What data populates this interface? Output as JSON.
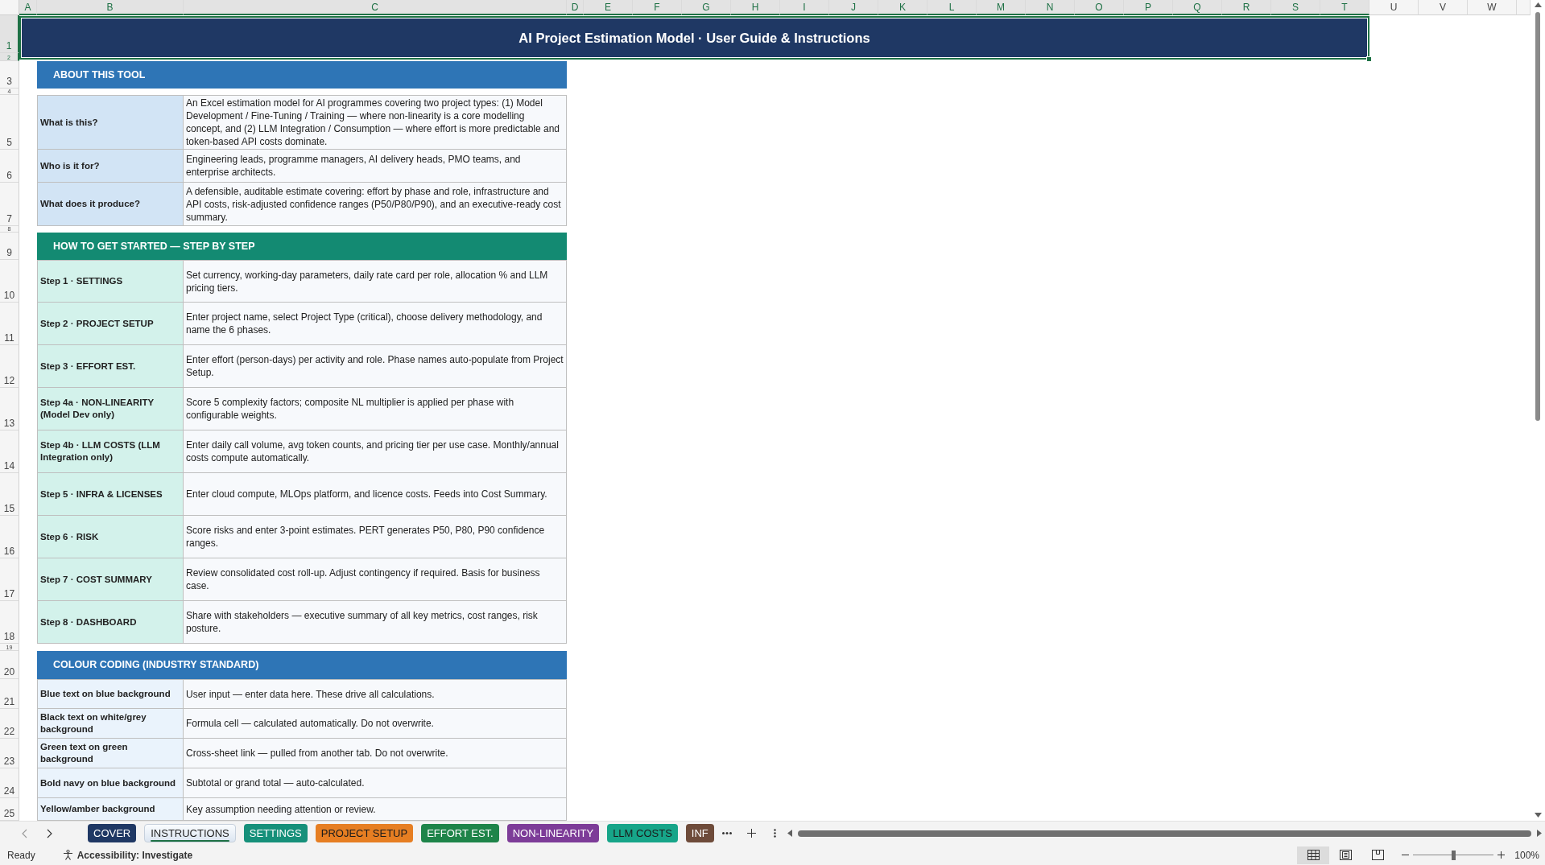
{
  "columns": [
    {
      "label": "A",
      "selected": true
    },
    {
      "label": "B",
      "selected": true
    },
    {
      "label": "C",
      "selected": true
    },
    {
      "label": "D",
      "selected": true
    },
    {
      "label": "E",
      "selected": true
    },
    {
      "label": "F",
      "selected": true
    },
    {
      "label": "G",
      "selected": true
    },
    {
      "label": "H",
      "selected": true
    },
    {
      "label": "I",
      "selected": true
    },
    {
      "label": "J",
      "selected": true
    },
    {
      "label": "K",
      "selected": true
    },
    {
      "label": "L",
      "selected": true
    },
    {
      "label": "M",
      "selected": true
    },
    {
      "label": "N",
      "selected": true
    },
    {
      "label": "O",
      "selected": true
    },
    {
      "label": "P",
      "selected": true
    },
    {
      "label": "Q",
      "selected": true
    },
    {
      "label": "R",
      "selected": true
    },
    {
      "label": "S",
      "selected": true
    },
    {
      "label": "T",
      "selected": true
    },
    {
      "label": "U",
      "selected": false
    },
    {
      "label": "V",
      "selected": false
    },
    {
      "label": "W",
      "selected": false
    }
  ],
  "rows": [
    {
      "label": "1",
      "selected": true
    },
    {
      "label": "2",
      "selected": true
    },
    {
      "label": "3",
      "selected": false
    },
    {
      "label": "4",
      "selected": false
    },
    {
      "label": "5",
      "selected": false
    },
    {
      "label": "6",
      "selected": false
    },
    {
      "label": "7",
      "selected": false
    },
    {
      "label": "8",
      "selected": false
    },
    {
      "label": "9",
      "selected": false
    },
    {
      "label": "10",
      "selected": false
    },
    {
      "label": "11",
      "selected": false
    },
    {
      "label": "12",
      "selected": false
    },
    {
      "label": "13",
      "selected": false
    },
    {
      "label": "14",
      "selected": false
    },
    {
      "label": "15",
      "selected": false
    },
    {
      "label": "16",
      "selected": false
    },
    {
      "label": "17",
      "selected": false
    },
    {
      "label": "18",
      "selected": false
    },
    {
      "label": "19",
      "selected": false
    },
    {
      "label": "20",
      "selected": false
    },
    {
      "label": "21",
      "selected": false
    },
    {
      "label": "22",
      "selected": false
    },
    {
      "label": "23",
      "selected": false
    },
    {
      "label": "24",
      "selected": false
    },
    {
      "label": "25",
      "selected": false
    }
  ],
  "title": {
    "text": "AI Project Estimation Model · User Guide & Instructions",
    "selected": true
  },
  "sections": [
    {
      "kind": "about",
      "heading": "ABOUT THIS TOOL",
      "color": "#2e75b6",
      "items": [
        {
          "label": "What is this?",
          "text": "An Excel estimation model for AI programmes covering two project types: (1) Model Development / Fine-Tuning / Training — where non-linearity is a core modelling concept, and (2) LLM Integration / Consumption — where effort is more predictable and token-based API costs dominate."
        },
        {
          "label": "Who is it for?",
          "text": "Engineering leads, programme managers, AI delivery heads, PMO teams, and enterprise architects."
        },
        {
          "label": "What does it produce?",
          "text": "A defensible, auditable estimate covering: effort by phase and role, infrastructure and API costs, risk-adjusted confidence ranges (P50/P80/P90), and an executive-ready cost summary."
        }
      ]
    },
    {
      "kind": "steps",
      "heading": "HOW TO GET STARTED — STEP BY STEP",
      "color": "#138a72",
      "items": [
        {
          "label": "Step 1 · SETTINGS",
          "text": "Set currency, working-day parameters, daily rate card per role, allocation % and LLM pricing tiers."
        },
        {
          "label": "Step 2 · PROJECT SETUP",
          "text": "Enter project name, select Project Type (critical), choose delivery methodology, and name the 6 phases."
        },
        {
          "label": "Step 3 · EFFORT EST.",
          "text": "Enter effort (person-days) per activity and role. Phase names auto-populate from Project Setup."
        },
        {
          "label": "Step 4a · NON-LINEARITY (Model Dev only)",
          "text": "Score 5 complexity factors; composite NL multiplier is applied per phase with configurable weights."
        },
        {
          "label": "Step 4b · LLM COSTS (LLM Integration only)",
          "text": "Enter daily call volume, avg token counts, and pricing tier per use case. Monthly/annual costs compute automatically."
        },
        {
          "label": "Step 5 · INFRA & LICENSES",
          "text": "Enter cloud compute, MLOps platform, and licence costs. Feeds into Cost Summary."
        },
        {
          "label": "Step 6 · RISK",
          "text": "Score risks and enter 3-point estimates. PERT generates P50, P80, P90 confidence ranges."
        },
        {
          "label": "Step 7 · COST SUMMARY",
          "text": "Review consolidated cost roll-up. Adjust contingency if required. Basis for business case."
        },
        {
          "label": "Step 8 · DASHBOARD",
          "text": "Share with stakeholders — executive summary of all key metrics, cost ranges, risk posture."
        }
      ]
    },
    {
      "kind": "legend",
      "heading": "COLOUR CODING (INDUSTRY STANDARD)",
      "color": "#2e75b6",
      "items": [
        {
          "label": "Blue text on blue background",
          "text": "User input — enter data here. These drive all calculations."
        },
        {
          "label": "Black text on white/grey background",
          "text": "Formula cell — calculated automatically. Do not overwrite."
        },
        {
          "label": "Green text on green background",
          "text": "Cross-sheet link — pulled from another tab. Do not overwrite."
        },
        {
          "label": "Bold navy on blue background",
          "text": "Subtotal or grand total — auto-calculated."
        },
        {
          "label": "Yellow/amber background",
          "text": "Key assumption needing attention or review."
        }
      ]
    }
  ],
  "sheet_tabs": [
    {
      "label": "COVER",
      "color": "#1f3864",
      "selected": false
    },
    {
      "label": "INSTRUCTIONS",
      "selected": true
    },
    {
      "label": "SETTINGS",
      "color": "#16907a",
      "selected": false
    },
    {
      "label": "PROJECT SETUP",
      "color": "#e67e22",
      "selected": false
    },
    {
      "label": "EFFORT EST.",
      "color": "#1e8449",
      "selected": false
    },
    {
      "label": "NON-LINEARITY",
      "color": "#7d3c98",
      "selected": false
    },
    {
      "label": "LLM COSTS",
      "color": "#17a589",
      "selected": false
    },
    {
      "label": "INF",
      "color": "#6e4b3a",
      "selected": false
    }
  ],
  "status_bar": {
    "status": "Ready",
    "accessibility": "Accessibility: Investigate",
    "views": [
      {
        "kind": "normal",
        "selected": true
      },
      {
        "kind": "page_layout",
        "selected": false
      },
      {
        "kind": "page_break",
        "selected": false
      }
    ],
    "zoom": {
      "level": 0.5,
      "reading": "100%"
    }
  }
}
